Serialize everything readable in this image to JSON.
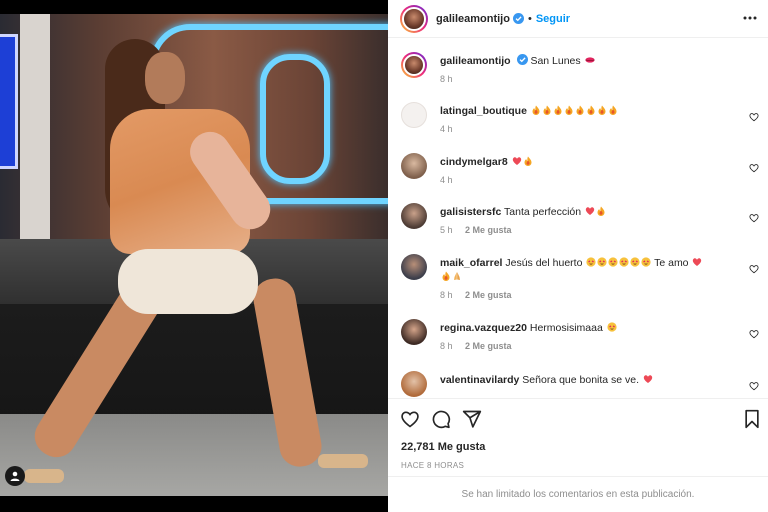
{
  "post": {
    "author": "galileamontijo",
    "follow_label": "Seguir",
    "separator": "•",
    "caption": "San Lunes",
    "caption_time": "8 h",
    "likes": "22,781 Me gusta",
    "time_ago": "HACE 8 HORAS",
    "comments_limited": "Se han limitado los comentarios en esta publicación."
  },
  "comments": [
    {
      "user": "latingal_boutique",
      "text": "",
      "emoji": "fire ×8",
      "time": "4 h",
      "likes": ""
    },
    {
      "user": "cindymelgar8",
      "text": "",
      "emoji": "heart, fire",
      "time": "4 h",
      "likes": ""
    },
    {
      "user": "galisistersfc",
      "text": "Tanta perfección",
      "emoji": "heart, fire",
      "time": "5 h",
      "likes": "2 Me gusta"
    },
    {
      "user": "maik_ofarrel",
      "text": "Jesús del huerto",
      "text2": "Te amo",
      "emoji": "star-struck ×6, heart, fire, pray",
      "time": "8 h",
      "likes": "2 Me gusta"
    },
    {
      "user": "regina.vazquez20",
      "text": "Hermosisimaaa",
      "emoji": "star-struck",
      "time": "8 h",
      "likes": "2 Me gusta"
    },
    {
      "user": "valentinavilardy",
      "text": "Señora que bonita se ve.",
      "emoji": "heart",
      "time": "",
      "likes": ""
    }
  ],
  "colors": {
    "accent": "#0095f6",
    "verified": "#3897f0",
    "heart": "#ed4956",
    "fire": "#f5a623"
  },
  "icons": [
    "more-icon",
    "verified-icon",
    "heart-icon",
    "comment-icon",
    "share-icon",
    "bookmark-icon",
    "tag-user-icon",
    "fire-emoji",
    "heart-emoji",
    "star-struck-emoji",
    "pray-emoji"
  ]
}
